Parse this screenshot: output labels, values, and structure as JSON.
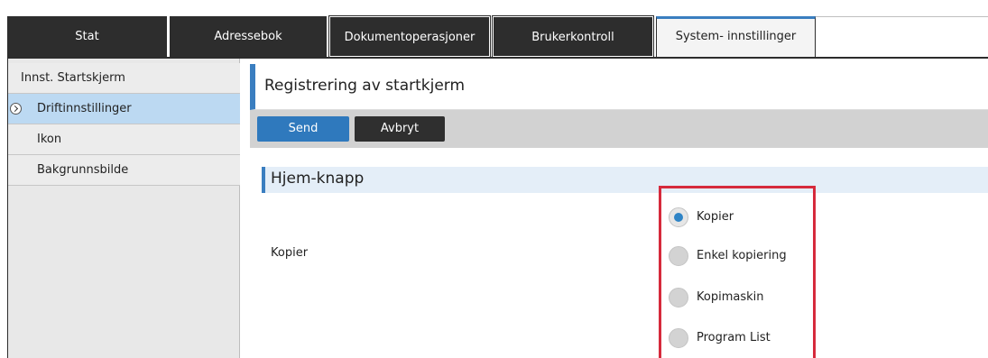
{
  "tabs": [
    {
      "label": "Stat"
    },
    {
      "label": "Adressebok"
    },
    {
      "label": "Dokumentoperasjoner"
    },
    {
      "label": "Brukerkontroll"
    },
    {
      "label": "System- innstillinger",
      "active": true
    }
  ],
  "sidebar": {
    "items": [
      {
        "label": "Innst. Startskjerm"
      },
      {
        "label": "Driftinnstillinger",
        "active": true
      },
      {
        "label": "Ikon"
      },
      {
        "label": "Bakgrunnsbilde"
      }
    ]
  },
  "main": {
    "title": "Registrering av startkjerm",
    "send_label": "Send",
    "cancel_label": "Avbryt",
    "section_title": "Hjem-knapp",
    "field_label": "Kopier",
    "options": [
      {
        "label": "Kopier",
        "selected": true
      },
      {
        "label": "Enkel kopiering",
        "selected": false
      },
      {
        "label": "Kopimaskin",
        "selected": false
      },
      {
        "label": "Program List",
        "selected": false
      }
    ]
  },
  "colors": {
    "accent": "#3a7ec0",
    "highlight": "#d62a3c",
    "tab_dark": "#2d2d2d",
    "sidebar_active": "#bcd9f2"
  }
}
